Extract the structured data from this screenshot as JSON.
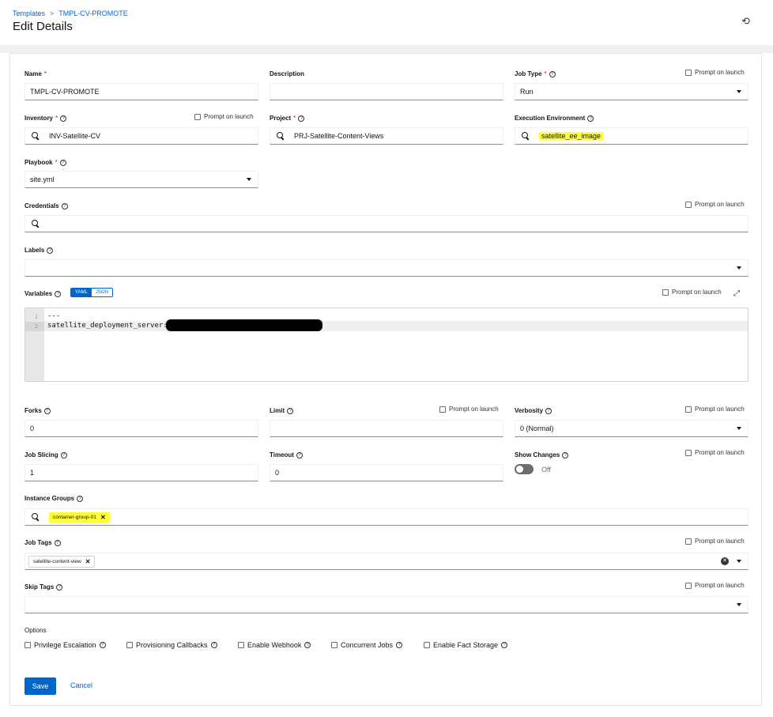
{
  "breadcrumb": {
    "root": "Templates",
    "current": "TMPL-CV-PROMOTE"
  },
  "page": {
    "title": "Edit Details"
  },
  "prompt_label": "Prompt on launch",
  "fields": {
    "name": {
      "label": "Name",
      "value": "TMPL-CV-PROMOTE"
    },
    "description": {
      "label": "Description",
      "value": ""
    },
    "job_type": {
      "label": "Job Type",
      "value": "Run"
    },
    "inventory": {
      "label": "Inventory",
      "value": "INV-Satellite-CV"
    },
    "project": {
      "label": "Project",
      "value": "PRJ-Satellite-Content-Views"
    },
    "execution_environment": {
      "label": "Execution Environment",
      "value": "satellite_ee_image"
    },
    "playbook": {
      "label": "Playbook",
      "value": "site.yml"
    },
    "credentials": {
      "label": "Credentials",
      "value": ""
    },
    "labels": {
      "label": "Labels",
      "value": ""
    },
    "variables": {
      "label": "Variables",
      "mode_yaml": "YAML",
      "mode_json": "JSON",
      "lines": [
        "---",
        "satellite_deployment_server:"
      ],
      "line_numbers": [
        "1",
        "2"
      ]
    },
    "forks": {
      "label": "Forks",
      "value": "0"
    },
    "limit": {
      "label": "Limit",
      "value": ""
    },
    "verbosity": {
      "label": "Verbosity",
      "value": "0 (Normal)"
    },
    "job_slicing": {
      "label": "Job Slicing",
      "value": "1"
    },
    "timeout": {
      "label": "Timeout",
      "value": "0"
    },
    "show_changes": {
      "label": "Show Changes",
      "state": "Off"
    },
    "instance_groups": {
      "label": "Instance Groups",
      "chip": "container-group-01"
    },
    "job_tags": {
      "label": "Job Tags",
      "chip": "satellite-content-view"
    },
    "skip_tags": {
      "label": "Skip Tags",
      "value": ""
    }
  },
  "options": {
    "title": "Options",
    "items": [
      "Privilege Escalation",
      "Provisioning Callbacks",
      "Enable Webhook",
      "Concurrent Jobs",
      "Enable Fact Storage"
    ]
  },
  "actions": {
    "save": "Save",
    "cancel": "Cancel"
  },
  "colors": {
    "primary": "#0066cc",
    "highlight": "#ffff33",
    "required": "#c9190b"
  }
}
